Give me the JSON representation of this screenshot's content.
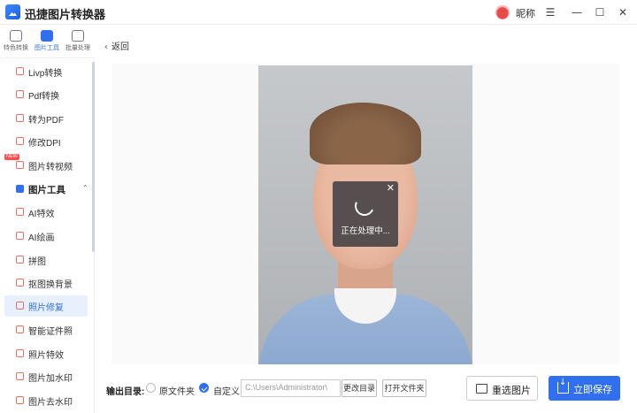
{
  "app": {
    "title": "迅捷图片转换器",
    "user_name": "昵称"
  },
  "window_controls": {
    "menu": "☰",
    "minimize": "—",
    "maximize": "☐",
    "close": "✕"
  },
  "top_tabs": [
    {
      "label": "特色转换",
      "icon": "feature-icon",
      "active": false
    },
    {
      "label": "图片工具",
      "icon": "image-tools-icon",
      "active": true
    },
    {
      "label": "批量处理",
      "icon": "batch-icon",
      "active": false
    }
  ],
  "sidebar": {
    "new_badge": "NEW",
    "items": [
      {
        "label": "Livp转换",
        "icon": "livp-icon"
      },
      {
        "label": "Pdf转换",
        "icon": "pdf-icon"
      },
      {
        "label": "转为PDF",
        "icon": "to-pdf-icon"
      },
      {
        "label": "修改DPI",
        "icon": "dpi-icon"
      },
      {
        "label": "图片转视频",
        "icon": "video-icon"
      },
      {
        "label": "图片工具",
        "icon": "image-tools-icon",
        "group": true
      },
      {
        "label": "AI特效",
        "icon": "ai-effect-icon"
      },
      {
        "label": "AI绘画",
        "icon": "ai-paint-icon"
      },
      {
        "label": "拼图",
        "icon": "puzzle-icon"
      },
      {
        "label": "抠图换背景",
        "icon": "cutout-icon"
      },
      {
        "label": "照片修复",
        "icon": "repair-icon",
        "active": true
      },
      {
        "label": "智能证件照",
        "icon": "id-photo-icon"
      },
      {
        "label": "照片特效",
        "icon": "photo-effect-icon"
      },
      {
        "label": "图片加水印",
        "icon": "watermark-add-icon"
      },
      {
        "label": "图片去水印",
        "icon": "watermark-remove-icon"
      }
    ]
  },
  "main": {
    "back_label": "返回",
    "processing_text": "正在处理中...",
    "close_glyph": "✕"
  },
  "bottom": {
    "output_label": "输出目录:",
    "option_original": "原文件夹",
    "option_custom": "自定义",
    "path_value": "C:\\Users\\Administrator\\",
    "change_dir_label": "更改目录",
    "open_folder_label": "打开文件夹",
    "reselect_label": "重选图片",
    "save_label": "立即保存"
  },
  "colors": {
    "accent": "#2f6ff0",
    "overlay": "#37373e"
  }
}
